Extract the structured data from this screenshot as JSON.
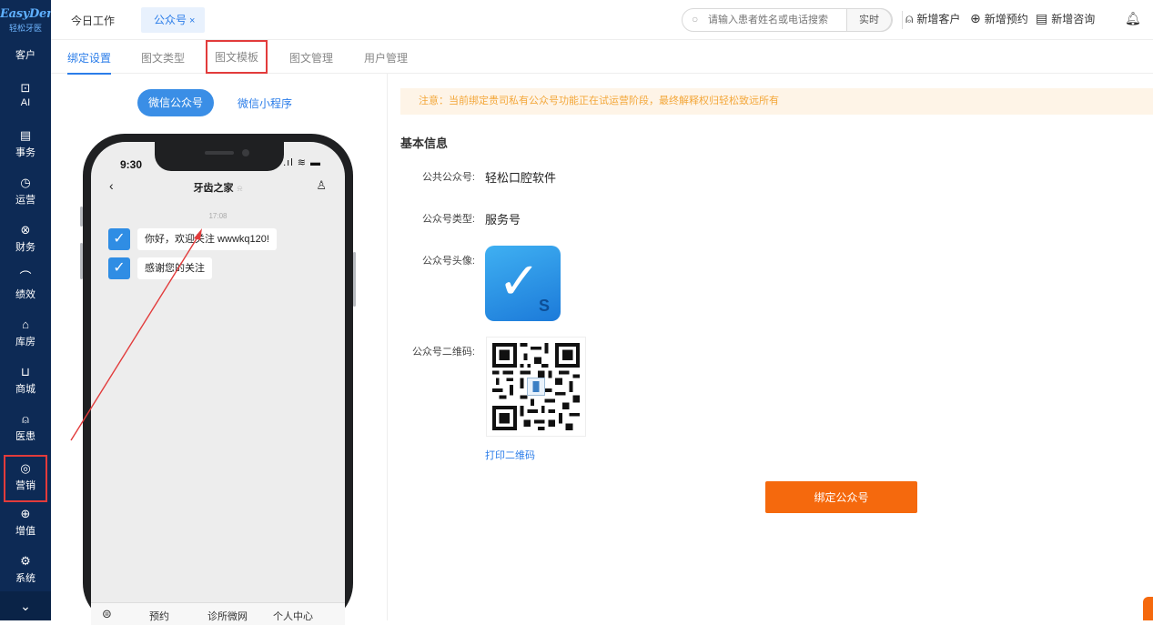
{
  "sidebar": {
    "logo": "EasyDent",
    "logo_sub": "轻松牙医",
    "top_item": "客户",
    "items": [
      {
        "label": "AI",
        "icon": "ai-icon",
        "glyph": "⊡"
      },
      {
        "label": "事务",
        "icon": "clipboard-icon",
        "glyph": "▤"
      },
      {
        "label": "运营",
        "icon": "clock-icon",
        "glyph": "◷"
      },
      {
        "label": "财务",
        "icon": "finance-icon",
        "glyph": "⊗"
      },
      {
        "label": "绩效",
        "icon": "chart-icon",
        "glyph": "⌒"
      },
      {
        "label": "库房",
        "icon": "warehouse-icon",
        "glyph": "⌂"
      },
      {
        "label": "商城",
        "icon": "cart-icon",
        "glyph": "⊔"
      },
      {
        "label": "医患",
        "icon": "users-icon",
        "glyph": "⍝"
      },
      {
        "label": "营销",
        "icon": "marketing-icon",
        "glyph": "◎"
      },
      {
        "label": "增值",
        "icon": "gift-icon",
        "glyph": "⊕"
      },
      {
        "label": "系统",
        "icon": "settings-icon",
        "glyph": "⚙"
      }
    ],
    "active_index": 8,
    "collapse_glyph": "⌄"
  },
  "topbar": {
    "home_tab": "今日工作",
    "active_tab": "公众号",
    "close_glyph": "×",
    "search_placeholder": "请输入患者姓名或电话搜索",
    "realtime_label": "实时",
    "new_customer": "新增客户",
    "new_appointment": "新增预约",
    "new_consult": "新增咨询"
  },
  "subtabs": [
    "绑定设置",
    "图文类型",
    "图文模板",
    "图文管理",
    "用户管理"
  ],
  "preview": {
    "wechat_official": "微信公众号",
    "wechat_mini": "微信小程序",
    "phone_time": "9:30",
    "chat_title": "牙齿之家",
    "chat_time": "17:08",
    "messages": [
      "你好，欢迎关注 wwwkq120!",
      "感谢您的关注"
    ],
    "tabbar": [
      "预约",
      "诊所微网",
      "个人中心"
    ]
  },
  "notice": "注意：当前绑定贵司私有公众号功能正在试运营阶段，最终解释权归轻松致远所有",
  "basic_info": {
    "title": "基本信息",
    "account_label": "公共公众号:",
    "account_value": "轻松口腔软件",
    "type_label": "公众号类型:",
    "type_value": "服务号",
    "avatar_label": "公众号头像:",
    "qr_label": "公众号二维码:",
    "print_qr": "打印二维码",
    "bind_button": "绑定公众号"
  },
  "colors": {
    "sidebar_bg": "#0d2a55",
    "accent": "#2b7de9",
    "bind_orange": "#f5690d",
    "highlight_red": "#e23b3b",
    "notice_text": "#f3a73a"
  }
}
